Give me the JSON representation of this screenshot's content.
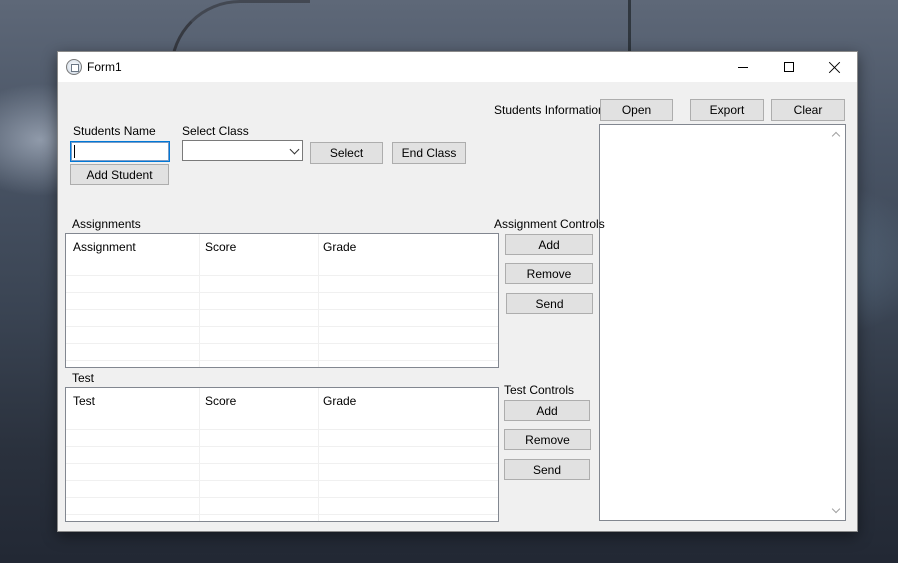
{
  "window": {
    "title": "Form1",
    "icons": {
      "app": "form-app-icon",
      "minimize": "minimize-icon",
      "maximize": "maximize-icon",
      "close": "close-icon"
    }
  },
  "student": {
    "name_label": "Students Name",
    "name_value": "",
    "add_label": "Add Student"
  },
  "class": {
    "label": "Select Class",
    "selected": "",
    "select_label": "Select",
    "end_label": "End Class"
  },
  "info": {
    "label": "Students Information",
    "open_label": "Open",
    "export_label": "Export",
    "clear_label": "Clear"
  },
  "assignments": {
    "label": "Assignments",
    "columns": [
      "Assignment",
      "Score",
      "Grade"
    ],
    "controls_label": "Assignment Controls",
    "add_label": "Add",
    "remove_label": "Remove",
    "send_label": "Send"
  },
  "tests": {
    "label": "Test",
    "columns": [
      "Test",
      "Score",
      "Grade"
    ],
    "controls_label": "Test Controls",
    "add_label": "Add",
    "remove_label": "Remove",
    "send_label": "Send"
  }
}
